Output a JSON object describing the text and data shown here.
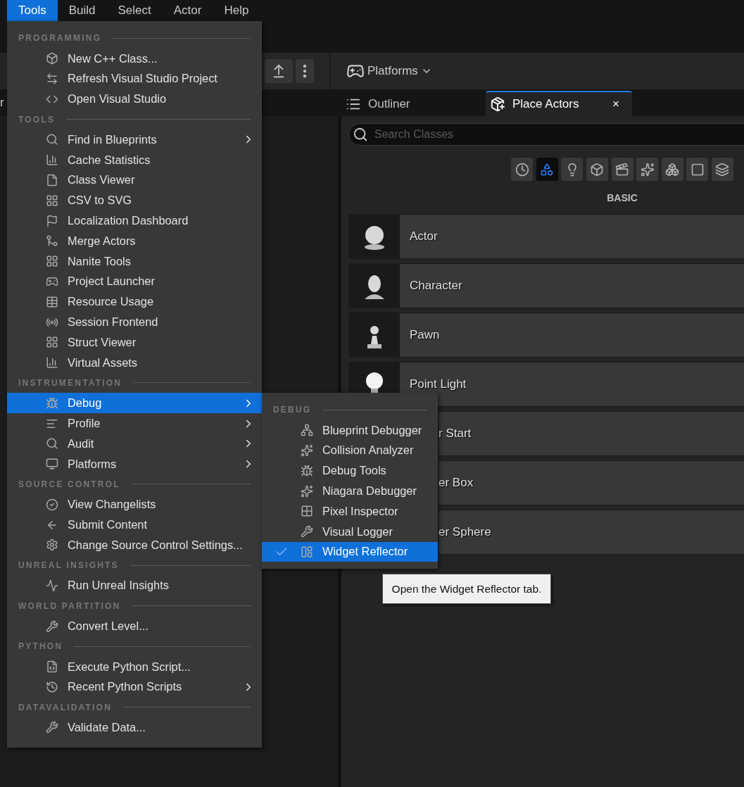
{
  "menu_bar": [
    {
      "label": "Tools",
      "selected": true
    },
    {
      "label": "Build",
      "selected": false
    },
    {
      "label": "Select",
      "selected": false
    },
    {
      "label": "Actor",
      "selected": false
    },
    {
      "label": "Help",
      "selected": false
    }
  ],
  "toolbar": {
    "platforms_label": "Platforms"
  },
  "left_tab_text": "r",
  "panel_tabs": [
    {
      "label": "Outliner",
      "selected": false
    },
    {
      "label": "Place Actors",
      "selected": true,
      "close": "×"
    }
  ],
  "search": {
    "placeholder": "Search Classes"
  },
  "categories": [
    {
      "selected": false
    },
    {
      "selected": true
    },
    {
      "selected": false
    },
    {
      "selected": false
    },
    {
      "selected": false
    },
    {
      "selected": false
    },
    {
      "selected": false
    },
    {
      "selected": false
    },
    {
      "selected": false
    }
  ],
  "category_title": "BASIC",
  "actors": [
    {
      "name": "Actor",
      "covered": false
    },
    {
      "name": "Character",
      "covered": false
    },
    {
      "name": "Pawn",
      "covered": false
    },
    {
      "name": "Point Light",
      "covered": false
    },
    {
      "name": "r Start",
      "covered": true
    },
    {
      "name": "er Box",
      "covered": true
    },
    {
      "name": "er Sphere",
      "covered": true
    }
  ],
  "tools_menu": {
    "sections": [
      {
        "title": "PROGRAMMING",
        "items": [
          {
            "label": "New C++ Class...",
            "submenu": false,
            "highlighted": false
          },
          {
            "label": "Refresh Visual Studio Project",
            "submenu": false,
            "highlighted": false
          },
          {
            "label": "Open Visual Studio",
            "submenu": false,
            "highlighted": false
          }
        ]
      },
      {
        "title": "TOOLS",
        "items": [
          {
            "label": "Find in Blueprints",
            "submenu": true,
            "highlighted": false
          },
          {
            "label": "Cache Statistics",
            "submenu": false,
            "highlighted": false
          },
          {
            "label": "Class Viewer",
            "submenu": false,
            "highlighted": false
          },
          {
            "label": "CSV to SVG",
            "submenu": false,
            "highlighted": false
          },
          {
            "label": "Localization Dashboard",
            "submenu": false,
            "highlighted": false
          },
          {
            "label": "Merge Actors",
            "submenu": false,
            "highlighted": false
          },
          {
            "label": "Nanite Tools",
            "submenu": false,
            "highlighted": false
          },
          {
            "label": "Project Launcher",
            "submenu": false,
            "highlighted": false
          },
          {
            "label": "Resource Usage",
            "submenu": false,
            "highlighted": false
          },
          {
            "label": "Session Frontend",
            "submenu": false,
            "highlighted": false
          },
          {
            "label": "Struct Viewer",
            "submenu": false,
            "highlighted": false
          },
          {
            "label": "Virtual Assets",
            "submenu": false,
            "highlighted": false
          }
        ]
      },
      {
        "title": "INSTRUMENTATION",
        "items": [
          {
            "label": "Debug",
            "submenu": true,
            "highlighted": true
          },
          {
            "label": "Profile",
            "submenu": true,
            "highlighted": false
          },
          {
            "label": "Audit",
            "submenu": true,
            "highlighted": false
          },
          {
            "label": "Platforms",
            "submenu": true,
            "highlighted": false
          }
        ]
      },
      {
        "title": "SOURCE CONTROL",
        "items": [
          {
            "label": "View Changelists",
            "submenu": false,
            "highlighted": false
          },
          {
            "label": "Submit Content",
            "submenu": false,
            "highlighted": false
          },
          {
            "label": "Change Source Control Settings...",
            "submenu": false,
            "highlighted": false
          }
        ]
      },
      {
        "title": "UNREAL INSIGHTS",
        "items": [
          {
            "label": "Run Unreal Insights",
            "submenu": false,
            "highlighted": false
          }
        ]
      },
      {
        "title": "WORLD PARTITION",
        "items": [
          {
            "label": "Convert Level...",
            "submenu": false,
            "highlighted": false
          }
        ]
      },
      {
        "title": "PYTHON",
        "items": [
          {
            "label": "Execute Python Script...",
            "submenu": false,
            "highlighted": false
          },
          {
            "label": "Recent Python Scripts",
            "submenu": true,
            "highlighted": false
          }
        ]
      },
      {
        "title": "DATAVALIDATION",
        "items": [
          {
            "label": "Validate Data...",
            "submenu": false,
            "highlighted": false
          }
        ]
      }
    ]
  },
  "debug_submenu": {
    "title": "DEBUG",
    "items": [
      {
        "label": "Blueprint Debugger",
        "checked": false,
        "highlighted": false
      },
      {
        "label": "Collision Analyzer",
        "checked": false,
        "highlighted": false
      },
      {
        "label": "Debug Tools",
        "checked": false,
        "highlighted": false
      },
      {
        "label": "Niagara Debugger",
        "checked": false,
        "highlighted": false
      },
      {
        "label": "Pixel Inspector",
        "checked": false,
        "highlighted": false
      },
      {
        "label": "Visual Logger",
        "checked": false,
        "highlighted": false
      },
      {
        "label": "Widget Reflector",
        "checked": true,
        "highlighted": true
      }
    ]
  },
  "tooltip": "Open the Widget Reflector tab."
}
